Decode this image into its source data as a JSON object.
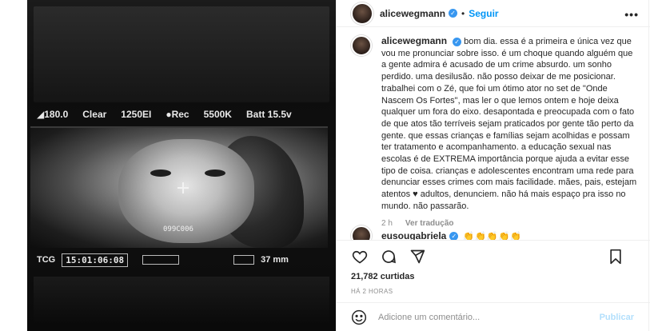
{
  "media": {
    "hud_top": {
      "angle": "180.0",
      "clear": "Clear",
      "iso": "1250EI",
      "rec": "Rec",
      "kelvin": "5500K",
      "battery": "Batt 15.5v"
    },
    "screen_code": "099C006",
    "hud_bottom": {
      "tcg": "TCG",
      "timecode": "15:01:06:08",
      "lens": "37 mm"
    }
  },
  "post": {
    "username": "alicewegmann",
    "follow_label": "Seguir",
    "more_icon": "more-horizontal-icon",
    "caption": {
      "username": "alicewegmann",
      "text": "bom dia. essa é a primeira e única vez que vou me pronunciar sobre isso. é um choque quando alguém que a gente admira é acusado de um crime absurdo. um sonho perdido. uma desilusão. não posso deixar de me posicionar. trabalhei com o Zé, que foi um ótimo ator no set de \"Onde Nascem Os Fortes\", mas ler o que lemos ontem e hoje deixa qualquer um fora do eixo. desapontada e preocupada com o fato de que atos tão terríveis sejam praticados por gente tão perto da gente. que essas crianças e famílias sejam acolhidas e possam ter tratamento e acompanhamento. a educação sexual nas escolas é de EXTREMA importância porque ajuda a evitar esse tipo de coisa. crianças e adolescentes encontram uma rede para denunciar esses crimes com mais facilidade. mães, pais, estejam atentos ♥ adultos, denunciem. não há mais espaço pra isso no mundo. não passarão.",
      "time": "2 h",
      "translate_label": "Ver tradução"
    },
    "comment": {
      "username": "eusougabriela",
      "emojis": "👏👏👏👏👏"
    },
    "likes": "21,782 curtidas",
    "timestamp": "HÁ 2 HORAS",
    "add_comment": {
      "placeholder": "Adicione um comentário...",
      "publish_label": "Publicar"
    }
  },
  "colors": {
    "accent": "#0095f6",
    "verified": "#3897f0",
    "muted": "#8e8e8e",
    "text": "#262626"
  }
}
